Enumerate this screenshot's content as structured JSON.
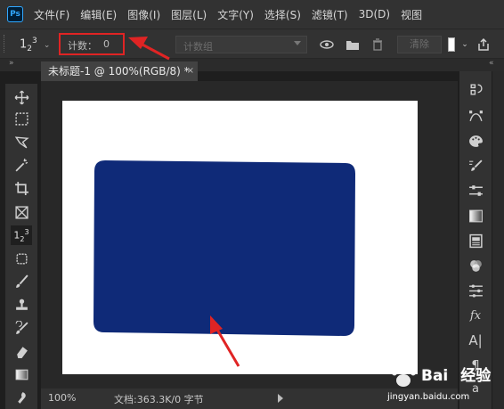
{
  "app": {
    "logo": "Ps",
    "menu": [
      "文件(F)",
      "编辑(E)",
      "图像(I)",
      "图层(L)",
      "文字(Y)",
      "选择(S)",
      "滤镜(T)",
      "3D(D)",
      "视图"
    ]
  },
  "options": {
    "tool_preset_base": "1",
    "tool_preset_sub": "2",
    "tool_preset_sup": "3",
    "count_label": "计数：",
    "count_value": "0",
    "count_group_placeholder": "计数组",
    "clear_label": "清除",
    "highlight_color": "#e02424"
  },
  "document": {
    "tab_title": "未标题-1 @ 100%(RGB/8) *",
    "tab_close": "×",
    "canvas_color": "#ffffff",
    "shape_color": "#0f2a78"
  },
  "status": {
    "zoom": "100%",
    "doc_info": "文档:363.3K/0 字节"
  },
  "collapse": {
    "left": "»",
    "right": "«"
  },
  "left_tools": [
    "move-tool-icon",
    "marquee-tool-icon",
    "lasso-tool-icon",
    "magic-wand-tool-icon",
    "crop-tool-icon",
    "frame-tool-icon",
    "count-tool-icon",
    "spot-healing-tool-icon",
    "brush-tool-icon",
    "stamp-tool-icon",
    "history-brush-tool-icon",
    "eraser-tool-icon",
    "gradient-tool-icon",
    "smudge-tool-icon"
  ],
  "right_panels": [
    "history-icon",
    "paths-icon",
    "color-icon",
    "brushes-icon",
    "adjustments-icon",
    "gradients-icon",
    "libraries-icon",
    "channels-icon",
    "properties-icon",
    "styles-icon",
    "character-icon",
    "paragraph-icon",
    "glyphs-icon"
  ],
  "watermark": {
    "brand_text": "Bai",
    "brand_suffix": "经验",
    "url": "jingyan.baidu.com"
  }
}
